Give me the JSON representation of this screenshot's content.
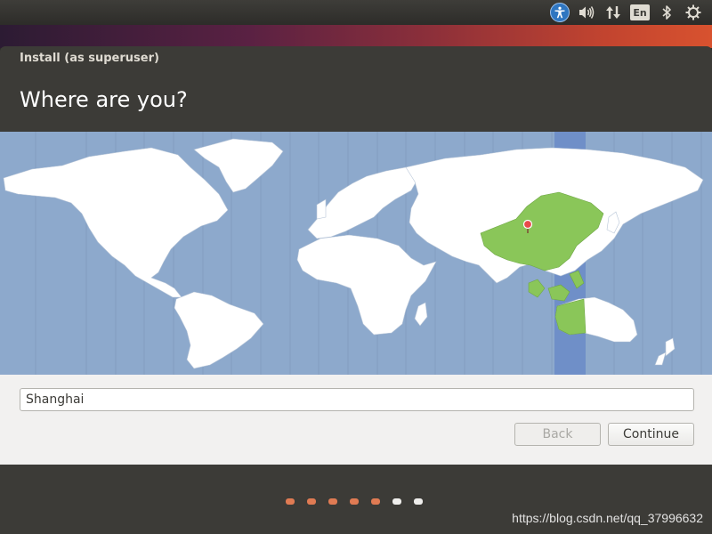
{
  "panel": {
    "accessibility_icon": "accessibility-icon",
    "volume_icon": "speaker-volume-icon",
    "network_icon": "network-updown-icon",
    "language_label": "En",
    "bluetooth_icon": "bluetooth-icon",
    "system_icon": "gear-icon"
  },
  "window": {
    "title": "Install (as superuser)",
    "heading": "Where are you?"
  },
  "map": {
    "selected_region": "China",
    "highlight_color": "#8ac659",
    "ocean_color": "#8da9cc",
    "timezone_band_color": "#6f8fc8",
    "pin_color": "#e84a4a"
  },
  "location": {
    "value": "Shanghai"
  },
  "buttons": {
    "back_label": "Back",
    "continue_label": "Continue"
  },
  "progress": {
    "total_steps": 7,
    "completed_steps": 5,
    "done_color": "#e07b53",
    "todo_color": "#efeeec"
  },
  "watermark": {
    "text": "https://blog.csdn.net/qq_37996632"
  }
}
